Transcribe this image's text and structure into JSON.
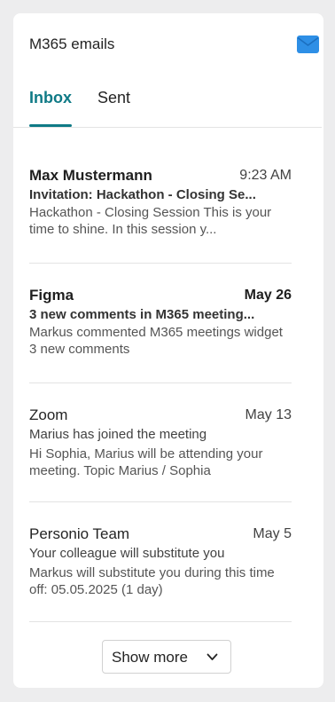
{
  "header": {
    "title": "M365 emails",
    "icon": "mail-icon"
  },
  "colors": {
    "accent": "#0f7a86",
    "mail_icon": "#2e8fe6"
  },
  "tabs": [
    {
      "label": "Inbox",
      "active": true
    },
    {
      "label": "Sent",
      "active": false
    }
  ],
  "emails": [
    {
      "sender": "Max Mustermann",
      "date": "9:23 AM",
      "subject": "Invitation: Hackathon - Closing Se...",
      "preview": "Hackathon - Closing Session This is your time to shine. In this session y...",
      "unread": true
    },
    {
      "sender": "Figma",
      "date": "May 26",
      "subject": "3 new comments in M365 meeting...",
      "preview": "Markus commented M365 meetings widget 3 new comments",
      "unread": true
    },
    {
      "sender": "Zoom",
      "date": "May 13",
      "subject": "Marius has joined the meeting",
      "preview": "Hi Sophia, Marius will be attending your meeting. Topic Marius / Sophia",
      "unread": false
    },
    {
      "sender": "Personio Team",
      "date": "May 5",
      "subject": "Your colleague will substitute you",
      "preview": "Markus will substitute you during this time off: 05.05.2025 (1 day)",
      "unread": false
    }
  ],
  "footer": {
    "show_more_label": "Show more",
    "show_more_icon": "chevron-down-icon"
  }
}
